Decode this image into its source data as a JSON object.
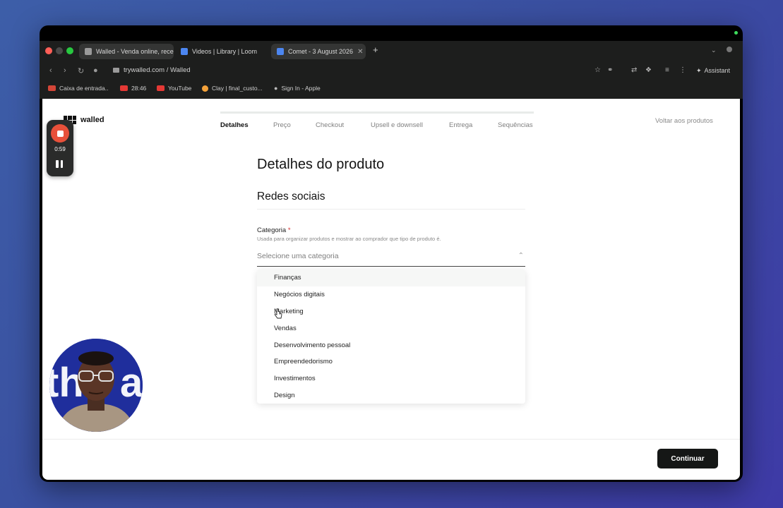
{
  "browser": {
    "tabs": [
      {
        "title": "Walled - Venda online, receb",
        "active": true
      },
      {
        "title": "Videos | Library | Loom",
        "active": false
      },
      {
        "title": "Comet - 3 August 2026",
        "active": true
      }
    ],
    "close_glyph": "✕",
    "new_tab_glyph": "+",
    "tab_menu_glyph": "⌄",
    "url": "trywalled.com / Walled",
    "assistant_label": "Assistant",
    "bookmarks": [
      {
        "label": "Caixa de entrada..",
        "color": "#d44638"
      },
      {
        "label": "28:46",
        "color": "#e53935"
      },
      {
        "label": "YouTube",
        "color": "#e53935"
      },
      {
        "label": "Clay | final_custo...",
        "color": "#f4a23a"
      },
      {
        "label": "Sign In - Apple",
        "color": "#bbbbbb"
      }
    ]
  },
  "recorder": {
    "time": "0:59"
  },
  "app": {
    "logo_text": "walled",
    "steps": [
      "Detalhes",
      "Preço",
      "Checkout",
      "Upsell e downsell",
      "Entrega",
      "Sequências"
    ],
    "active_step": "Detalhes",
    "back_link": "Voltar aos produtos",
    "page_title": "Detalhes do produto",
    "section_title": "Redes sociais",
    "category": {
      "label": "Categoria",
      "required_mark": "*",
      "hint": "Usada para organizar produtos e mostrar ao comprador que tipo de produto é.",
      "placeholder": "Selecione uma categoria",
      "options": [
        "Finanças",
        "Negócios digitais",
        "Marketing",
        "Vendas",
        "Desenvolvimento pessoal",
        "Empreendedorismo",
        "Investimentos",
        "Design"
      ],
      "highlighted_option": "Finanças"
    },
    "continue_label": "Continuar"
  },
  "colors": {
    "accent_dark": "#151716",
    "record_red": "#e8503a",
    "required_red": "#d62b2b"
  }
}
